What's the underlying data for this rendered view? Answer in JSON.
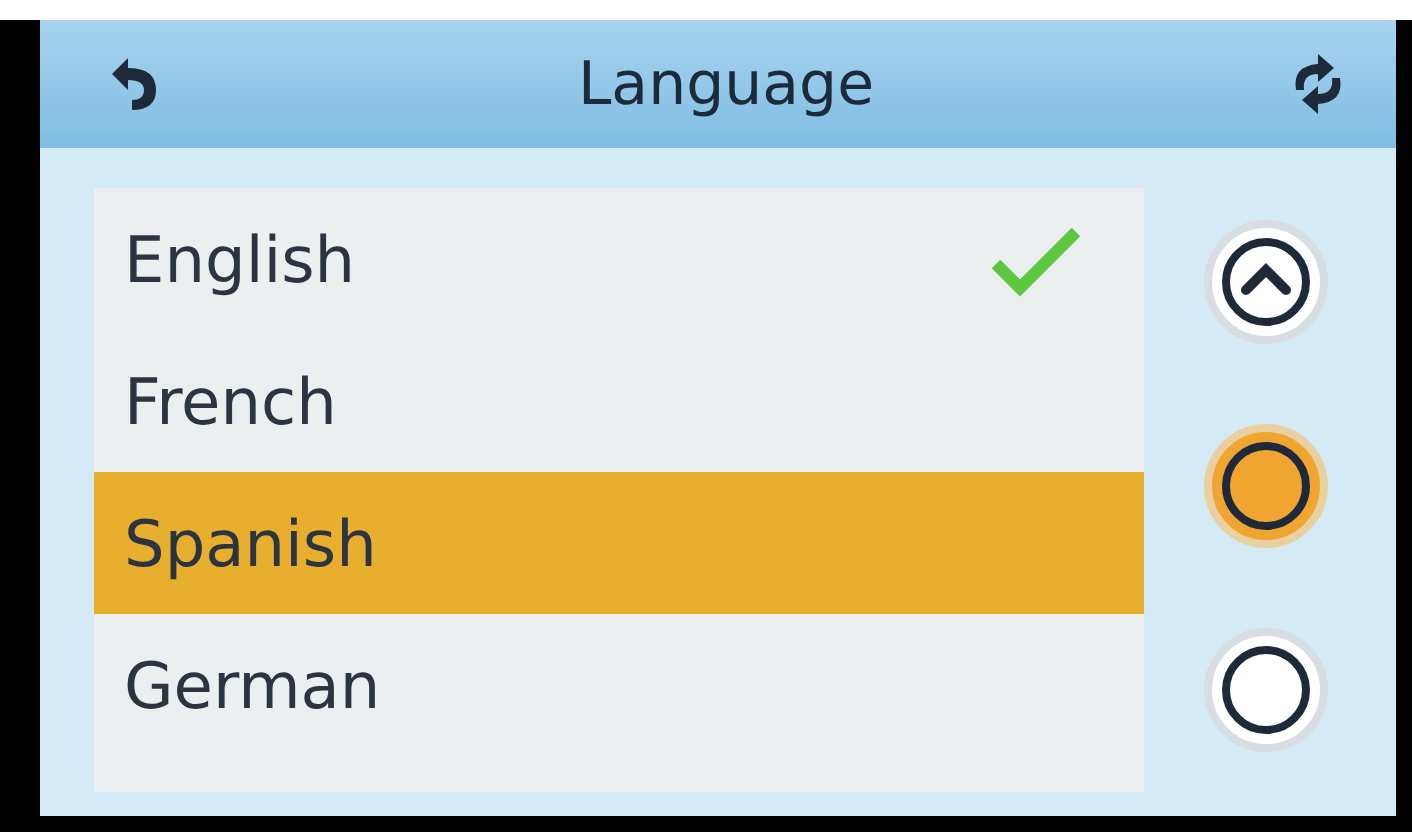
{
  "header": {
    "title": "Language"
  },
  "languages": [
    {
      "label": "English",
      "checked": true,
      "selected": false
    },
    {
      "label": "French",
      "checked": false,
      "selected": false
    },
    {
      "label": "Spanish",
      "checked": false,
      "selected": true
    },
    {
      "label": "German",
      "checked": false,
      "selected": false
    }
  ],
  "side_buttons": [
    {
      "kind": "up",
      "pressed": false
    },
    {
      "kind": "plain",
      "pressed": true
    },
    {
      "kind": "plain",
      "pressed": false
    }
  ]
}
